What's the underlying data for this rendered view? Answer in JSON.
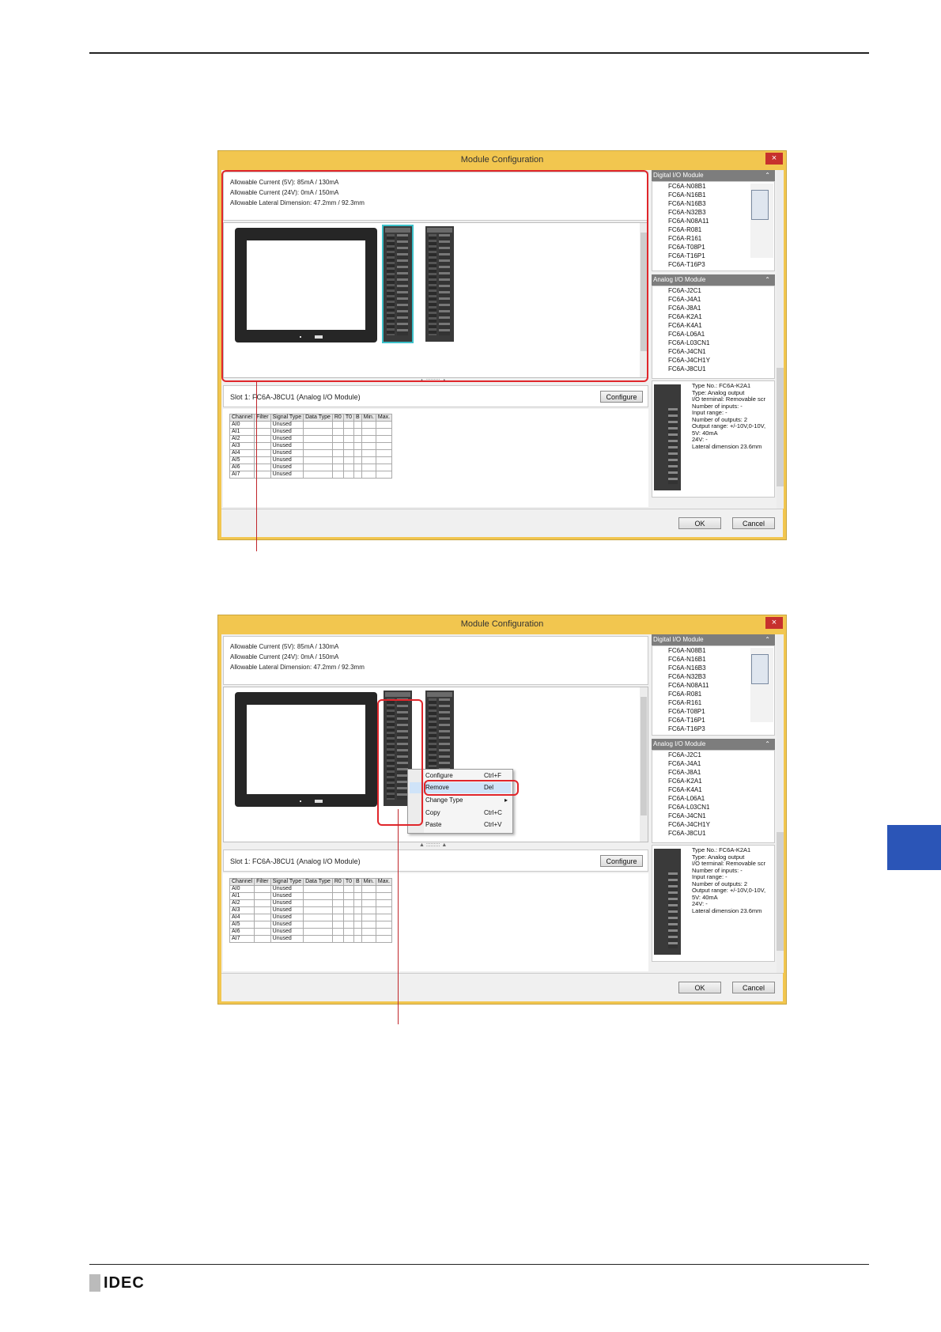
{
  "logo": {
    "text": "IDEC"
  },
  "windows": [
    {
      "title": "Module Configuration",
      "close": "×",
      "info": [
        "Allowable Current (5V): 85mA / 130mA",
        "Allowable Current (24V): 0mA / 150mA",
        "Allowable Lateral Dimension: 47.2mm / 92.3mm"
      ],
      "slot_label": "Slot 1: FC6A-J8CU1 (Analog I/O Module)",
      "configure_label": "Configure",
      "ok_label": "OK",
      "cancel_label": "Cancel"
    },
    {
      "title": "Module Configuration",
      "close": "×",
      "info": [
        "Allowable Current (5V): 85mA / 130mA",
        "Allowable Current (24V): 0mA / 150mA",
        "Allowable Lateral Dimension: 47.2mm / 92.3mm"
      ],
      "slot_label": "Slot 1: FC6A-J8CU1 (Analog I/O Module)",
      "configure_label": "Configure",
      "ok_label": "OK",
      "cancel_label": "Cancel"
    }
  ],
  "channel_table": {
    "headers": [
      "Channel",
      "Filter",
      "Signal Type",
      "Data Type",
      "R0",
      "T0",
      "B",
      "Min.",
      "Max."
    ],
    "rows": [
      [
        "AI0",
        "",
        "Unused"
      ],
      [
        "AI1",
        "",
        "Unused"
      ],
      [
        "AI2",
        "",
        "Unused"
      ],
      [
        "AI3",
        "",
        "Unused"
      ],
      [
        "AI4",
        "",
        "Unused"
      ],
      [
        "AI5",
        "",
        "Unused"
      ],
      [
        "AI6",
        "",
        "Unused"
      ],
      [
        "AI7",
        "",
        "Unused"
      ]
    ]
  },
  "digital_panel": {
    "title": "Digital I/O Module",
    "items": [
      "FC6A-N08B1",
      "FC6A-N16B1",
      "FC6A-N16B3",
      "FC6A-N32B3",
      "FC6A-N08A11",
      "FC6A-R081",
      "FC6A-R161",
      "FC6A-T08P1",
      "FC6A-T16P1",
      "FC6A-T16P3"
    ]
  },
  "analog_panel": {
    "title": "Analog I/O Module",
    "items": [
      "FC6A-J2C1",
      "FC6A-J4A1",
      "FC6A-J8A1",
      "FC6A-K2A1",
      "FC6A-K4A1",
      "FC6A-L06A1",
      "FC6A-L03CN1",
      "FC6A-J4CN1",
      "FC6A-J4CH1Y",
      "FC6A-J8CU1"
    ]
  },
  "detail": {
    "lines": [
      "Type No.: FC6A-K2A1",
      "Type: Analog output",
      "I/O terminal: Removable scr",
      "Number of inputs: -",
      "Input range: -",
      "Number of outputs: 2",
      "Output range: +/-10V,0-10V,",
      "5V: 40mA",
      "24V: -",
      "Lateral dimension 23.6mm"
    ]
  },
  "context_menu": {
    "items": [
      {
        "label": "Configure",
        "shortcut": "Ctrl+F"
      },
      {
        "label": "Remove",
        "shortcut": "Del"
      },
      {
        "label": "Change Type",
        "shortcut": "▸"
      },
      {
        "label": "Copy",
        "shortcut": "Ctrl+C"
      },
      {
        "label": "Paste",
        "shortcut": "Ctrl+V"
      }
    ]
  }
}
